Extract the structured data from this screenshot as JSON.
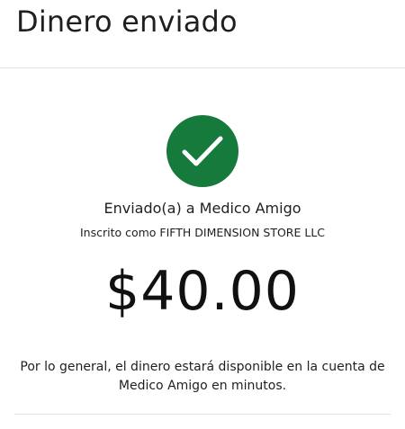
{
  "header": {
    "title": "Dinero enviado"
  },
  "status": {
    "icon": "check-circle-icon",
    "color": "#167a3c"
  },
  "recipient": {
    "sent_to": "Enviado(a) a Medico Amigo",
    "enrolled_as": "Inscrito como FIFTH DIMENSION STORE LLC"
  },
  "amount": "$40.00",
  "notice": "Por lo general, el dinero estará disponible en la cuenta de Medico Amigo en minutos."
}
